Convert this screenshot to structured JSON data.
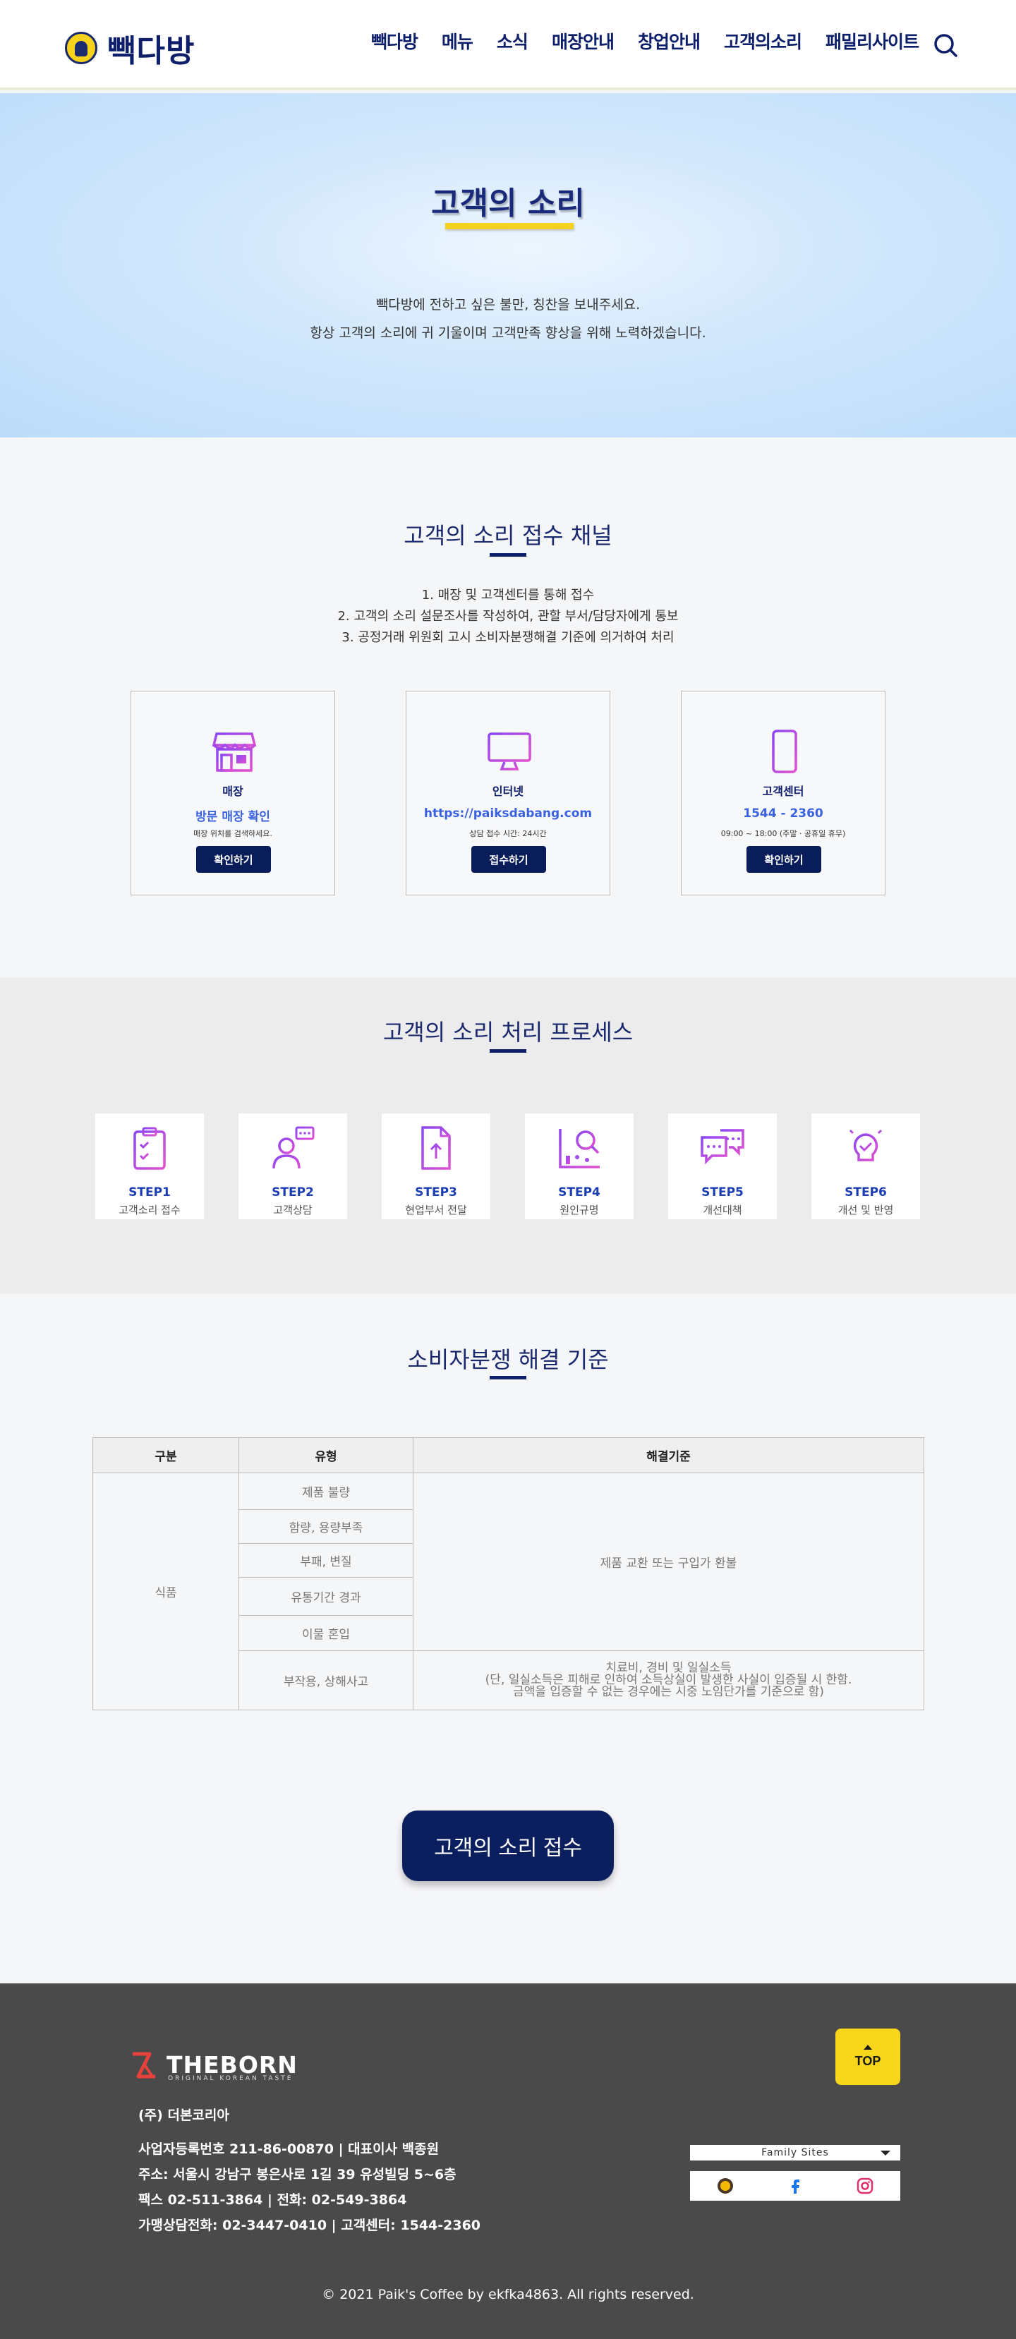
{
  "header": {
    "brand": "빽다방",
    "nav": [
      "빽다방",
      "메뉴",
      "소식",
      "매장안내",
      "창업안내",
      "고객의소리",
      "패밀리사이트"
    ]
  },
  "hero": {
    "title": "고객의 소리",
    "line1": "빽다방에 전하고 싶은 불만, 칭찬을 보내주세요.",
    "line2": "항상 고객의 소리에 귀 기울이며 고객만족 향상을 위해 노력하겠습니다."
  },
  "channels": {
    "title": "고객의 소리 접수 채널",
    "items": [
      "1. 매장 및 고객센터를 통해 접수",
      "2. 고객의 소리 설문조사를 작성하여, 관할 부서/담당자에게 통보",
      "3. 공정거래 위원회 고시 소비자분쟁해결 기준에 의거하여 처리"
    ],
    "cards": [
      {
        "label": "매장",
        "link": "방문 매장 확인",
        "desc": "매장 위치를 검색하세요.",
        "button": "확인하기",
        "icon": "store-icon"
      },
      {
        "label": "인터넷",
        "link": "https://paiksdabang.com",
        "desc": "상담 접수 시간: 24시간",
        "button": "접수하기",
        "icon": "monitor-icon"
      },
      {
        "label": "고객센터",
        "link": "1544 - 2360",
        "desc": "09:00 ~ 18:00 (주말 · 공휴일 휴무)",
        "button": "확인하기",
        "icon": "phone-icon"
      }
    ]
  },
  "process": {
    "title": "고객의 소리 처리 프로세스",
    "steps": [
      {
        "num": "STEP1",
        "text": "고객소리 접수",
        "icon": "clipboard-icon"
      },
      {
        "num": "STEP2",
        "text": "고객상담",
        "icon": "consultant-icon"
      },
      {
        "num": "STEP3",
        "text": "현업부서 전달",
        "icon": "document-upload-icon"
      },
      {
        "num": "STEP4",
        "text": "원인규명",
        "icon": "analysis-icon"
      },
      {
        "num": "STEP5",
        "text": "개선대책",
        "icon": "chat-bubbles-icon"
      },
      {
        "num": "STEP6",
        "text": "개선 및 반영",
        "icon": "lightbulb-icon"
      }
    ]
  },
  "dispute": {
    "title": "소비자분쟁 해결 기준",
    "headers": [
      "구분",
      "유형",
      "해결기준"
    ],
    "category": "식품",
    "types": [
      "제품 불량",
      "함량, 용량부족",
      "부패, 변질",
      "유통기간 경과",
      "이물 혼입",
      "부작용, 상해사고"
    ],
    "resolution1": "제품 교환 또는 구입가 환불",
    "resolution2_line1": "치료비, 경비 및 일실소득",
    "resolution2_line2": "(단, 일실소득은 피해로 인하여 소득상실이 발생한 사실이 입증될 시 한함.",
    "resolution2_line3": "금액을 입증할 수 없는 경우에는 시중 노임단가를 기준으로 함)"
  },
  "submit_button": "고객의 소리 접수",
  "footer": {
    "brand": "THEBORN",
    "brand_sub": "ORIGINAL KOREAN TASTE",
    "corp": "(주) 더본코리아",
    "lines": [
      "사업자등록번호 211-86-00870  |  대표이사 백종원",
      "주소: 서울시 강남구 봉은사로 1길 39 유성빌딩 5~6층",
      "팩스 02-511-3864  |  전화: 02-549-3864",
      "가맹상담전화: 02-3447-0410  |  고객센터: 1544-2360"
    ],
    "top_button": "TOP",
    "family_sites": "Family Sites",
    "copyright": "© 2021 Paik's Coffee by ekfka4863. All rights reserved."
  },
  "colors": {
    "navy": "#0d1f6a",
    "yellow": "#f2d21e",
    "accent_purple": "#a24bf0",
    "footer_bg": "#4a4a4a"
  }
}
